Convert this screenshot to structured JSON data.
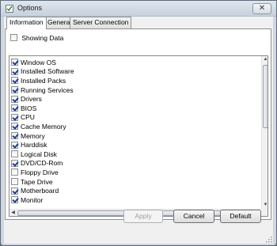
{
  "window": {
    "title": "Options",
    "close_symbol": "✕"
  },
  "tabs": [
    {
      "label": "Information",
      "active": true
    },
    {
      "label": "General",
      "active": false
    },
    {
      "label": "Server Connection",
      "active": false
    }
  ],
  "showing_data": {
    "label": "Showing Data",
    "checked": false
  },
  "items": [
    {
      "label": "Window OS",
      "checked": true
    },
    {
      "label": "Installed Software",
      "checked": true
    },
    {
      "label": "Installed Packs",
      "checked": true
    },
    {
      "label": "Running Services",
      "checked": true
    },
    {
      "label": "Drivers",
      "checked": true
    },
    {
      "label": "BIOS",
      "checked": true
    },
    {
      "label": "CPU",
      "checked": true
    },
    {
      "label": "Cache Memory",
      "checked": true
    },
    {
      "label": "Memory",
      "checked": true
    },
    {
      "label": "Harddisk",
      "checked": true
    },
    {
      "label": "Logical Disk",
      "checked": false
    },
    {
      "label": "DVD/CD-Rom",
      "checked": true
    },
    {
      "label": "Floppy Drive",
      "checked": false
    },
    {
      "label": "Tape Drive",
      "checked": false
    },
    {
      "label": "Motherboard",
      "checked": true
    },
    {
      "label": "Monitor",
      "checked": true
    }
  ],
  "scroll": {
    "up": "▲",
    "down": "▼",
    "left": "◀",
    "right": "▶",
    "grip": "|||"
  },
  "buttons": {
    "apply": "Apply",
    "cancel": "Cancel",
    "default": "Default"
  },
  "icons": {
    "app": "app-icon",
    "close": "close-icon",
    "check": "check-icon"
  },
  "colors": {
    "check_mark": "#1c3f94",
    "title_bar": "#cfd6df",
    "panel": "#ffffff"
  }
}
